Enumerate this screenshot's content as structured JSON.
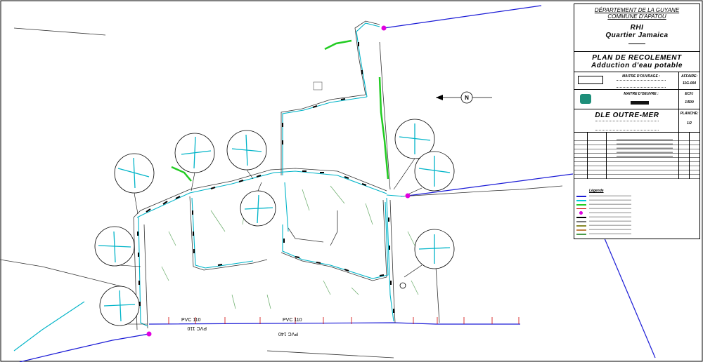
{
  "title_block": {
    "department": "DÉPARTEMENT DE LA GUYANE",
    "commune": "COMMUNE D'APATOU",
    "project_line1": "RHI",
    "project_line2": "Quartier Jamaica",
    "plan_line1": "PLAN DE RECOLEMENT",
    "plan_line2": "Adduction d'eau potable",
    "maitre_ouvrage_label": "MAITRE D'OUVRAGE :",
    "maitre_oeuvre_label": "MAITRE D'OEUVRE :",
    "company": "DLE OUTRE-MER",
    "affaire_label": "AFFAIRE:",
    "affaire_value": "11G-004",
    "echelle_label": "ECH:",
    "echelle_value": "1/500",
    "planche_label": "PLANCHE:",
    "planche_value": "1/2"
  },
  "legend": {
    "title": "Légende",
    "colors": {
      "main_pipe": "#1a1ad6",
      "cyan_pipe": "#00c8d8",
      "magenta_point": "#e000e0",
      "green_zone": "#22cc22",
      "red_point": "#d00000"
    }
  },
  "pipe_labels": {
    "label1": "PVC 110",
    "label2": "PVC 110",
    "label3": "PVC 110",
    "label4": "PVC 140"
  },
  "north_arrow": {
    "letter": "N"
  }
}
